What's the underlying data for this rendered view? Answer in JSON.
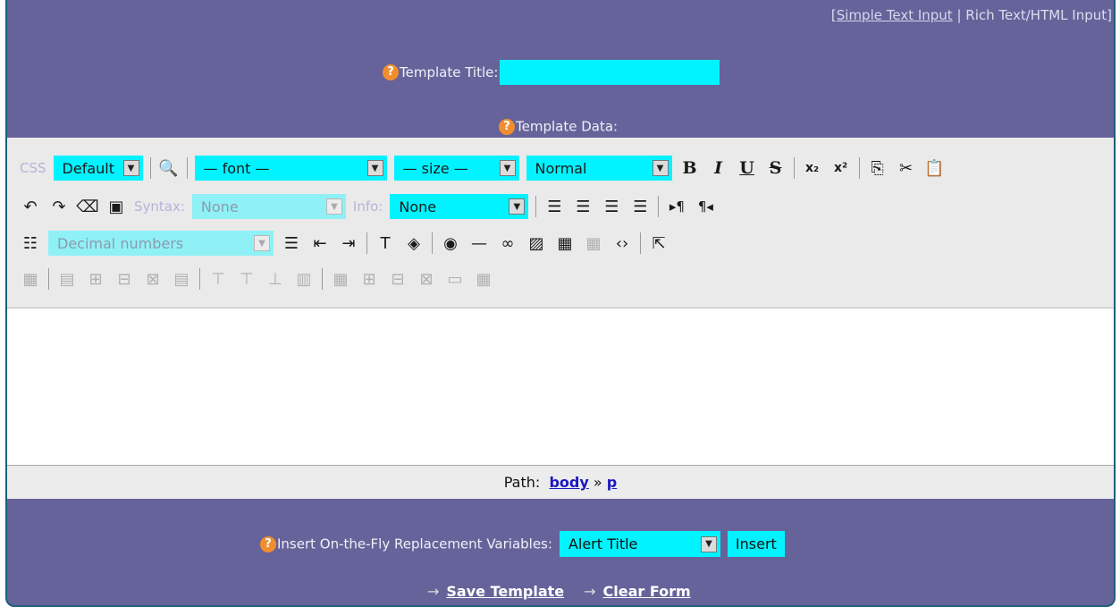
{
  "top_links": {
    "open_bracket": "[",
    "simple": "Simple Text Input",
    "divider": " | ",
    "rich": "Rich Text/HTML Input",
    "close_bracket": "]"
  },
  "help_glyph": "?",
  "template_title": {
    "label": "Template Title:",
    "value": ""
  },
  "template_data": {
    "label": "Template Data:"
  },
  "toolbar": {
    "row1": {
      "css_label": "CSS",
      "css_value": "Default",
      "font_value": "— font —",
      "size_value": "— size —",
      "format_value": "Normal",
      "bold": "B",
      "italic": "I",
      "underline": "U",
      "strike": "S",
      "subscript": "x₂",
      "superscript": "x²"
    },
    "row2": {
      "syntax_label": "Syntax:",
      "syntax_value": "None",
      "info_label": "Info:",
      "info_value": "None"
    },
    "row3": {
      "list_value": "Decimal numbers"
    }
  },
  "path_bar": {
    "label": "Path:",
    "body": "body",
    "sep": "»",
    "p": "p"
  },
  "variables": {
    "label": "Insert On-the-Fly Replacement Variables:",
    "value": "Alert Title",
    "insert": "Insert"
  },
  "actions": {
    "arrow": "→",
    "save": "Save Template",
    "clear": "Clear Form"
  },
  "colors": {
    "panel": "#66639a",
    "input": "#00f3ff",
    "help": "#f08e2f"
  }
}
